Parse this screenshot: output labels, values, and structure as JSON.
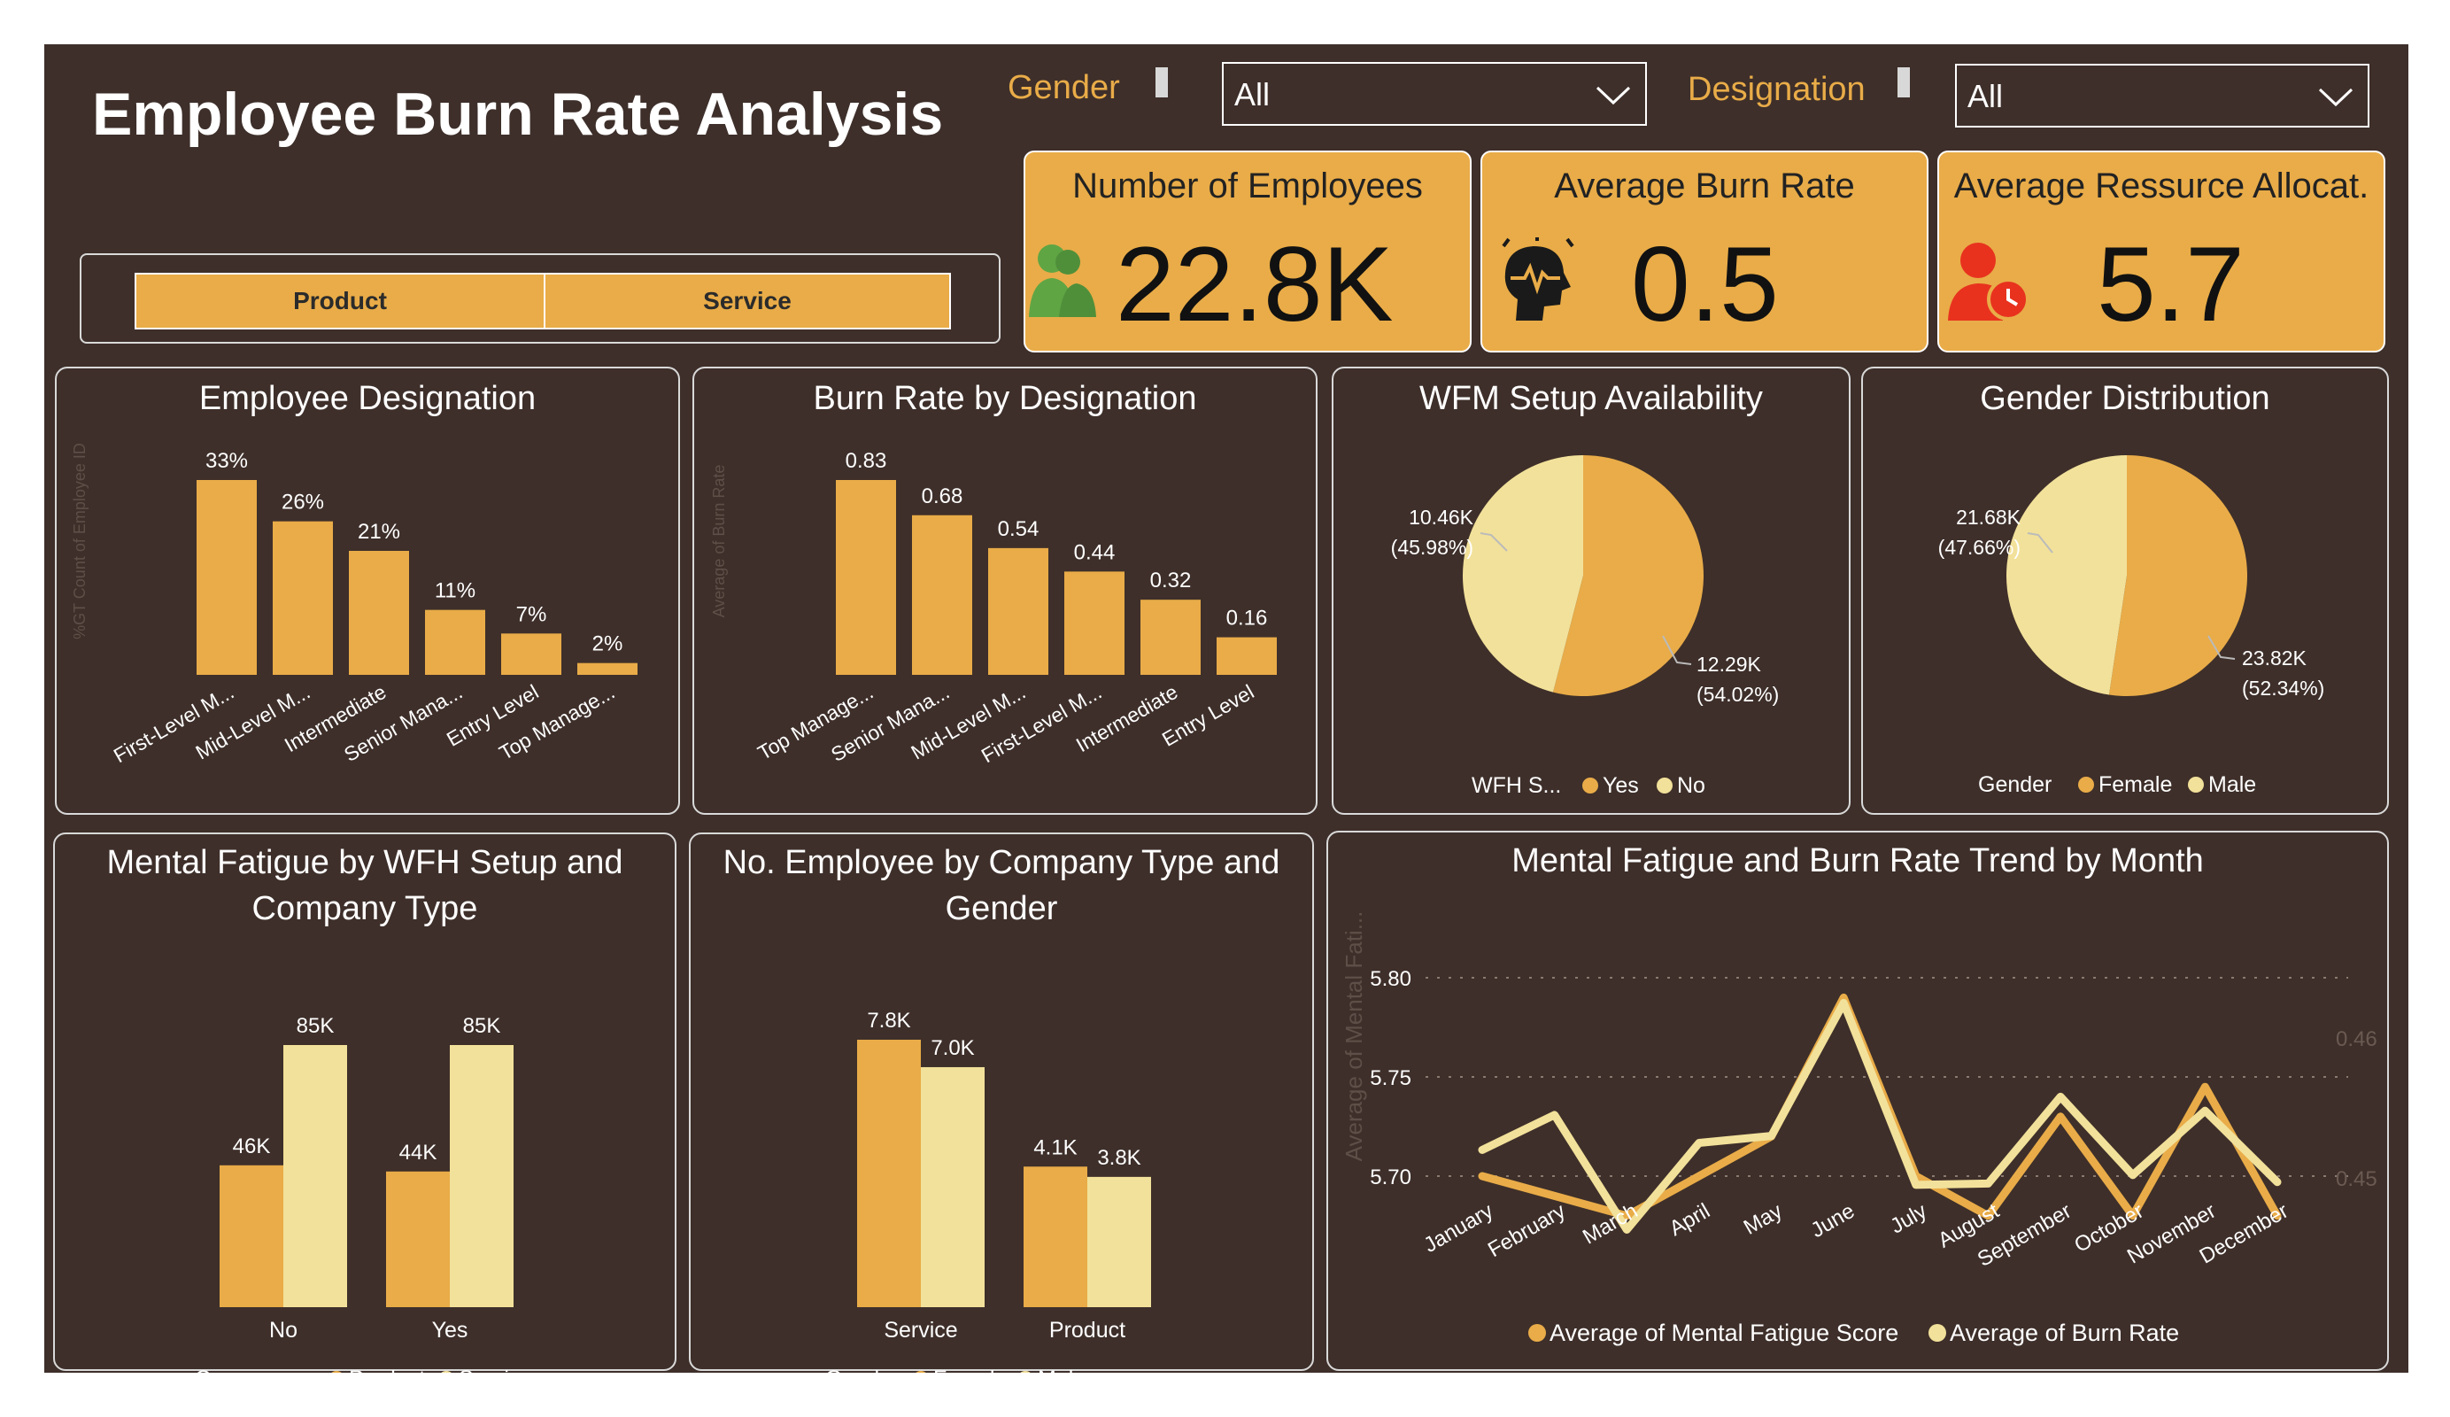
{
  "header": {
    "title": "Employee Burn Rate Analysis",
    "gender_filter": {
      "label": "Gender",
      "value": "All"
    },
    "designation_filter": {
      "label": "Designation",
      "value": "All"
    }
  },
  "slicer": {
    "buttons": [
      "Product",
      "Service"
    ]
  },
  "kpis": [
    {
      "title": "Number of Employees",
      "value": "22.8K",
      "icon": "people-icon"
    },
    {
      "title": "Average Burn Rate",
      "value": "0.5",
      "icon": "burnout-head-icon"
    },
    {
      "title": "Average Ressurce Allocat.",
      "value": "5.7",
      "icon": "user-clock-icon"
    }
  ],
  "colors": {
    "background": "#3e2f2a",
    "accent": "#e9ac48",
    "light": "#f2e19a",
    "text": "#ffffff"
  },
  "panels": {
    "designation": {
      "title": "Employee Designation",
      "ylabel": "%GT Count of Employee ID"
    },
    "burn_by_designation": {
      "title": "Burn Rate by Designation",
      "ylabel": "Average of Burn Rate"
    },
    "wfm": {
      "title": "WFM Setup Availability",
      "legend_title": "WFH S...",
      "legend": [
        "Yes",
        "No"
      ]
    },
    "gender": {
      "title": "Gender Distribution",
      "legend_title": "Gender",
      "legend": [
        "Female",
        "Male"
      ]
    },
    "mental_fatigue": {
      "title_line1": "Mental Fatigue by WFH Setup and",
      "title_line2": "Company Type",
      "legend_title": "Company ...",
      "legend": [
        "Product",
        "Service"
      ]
    },
    "employees_company": {
      "title_line1": "No. Employee by Company Type and",
      "title_line2": "Gender",
      "legend_title": "Gender",
      "legend": [
        "Female",
        "Male"
      ]
    },
    "trend": {
      "title": "Mental Fatigue and Burn Rate Trend by Month",
      "ylabel": "Average of Mental Fati...",
      "legend": [
        "Average of Mental Fatigue Score",
        "Average of Burn Rate"
      ]
    }
  },
  "chart_data": [
    {
      "type": "bar",
      "title": "Employee Designation",
      "ylabel": "%GT Count of Employee ID",
      "categories": [
        "First-Level M...",
        "Mid-Level M...",
        "Intermediate",
        "Senior Mana...",
        "Entry Level",
        "Top Manage..."
      ],
      "values": [
        33,
        26,
        21,
        11,
        7,
        2
      ],
      "labels": [
        "33%",
        "26%",
        "21%",
        "11%",
        "7%",
        "2%"
      ]
    },
    {
      "type": "bar",
      "title": "Burn Rate by Designation",
      "ylabel": "Average of Burn Rate",
      "categories": [
        "Top Manage...",
        "Senior Mana...",
        "Mid-Level M...",
        "First-Level M...",
        "Intermediate",
        "Entry Level"
      ],
      "values": [
        0.83,
        0.68,
        0.54,
        0.44,
        0.32,
        0.16
      ],
      "labels": [
        "0.83",
        "0.68",
        "0.54",
        "0.44",
        "0.32",
        "0.16"
      ]
    },
    {
      "type": "pie",
      "title": "WFM Setup Availability",
      "categories": [
        "Yes",
        "No"
      ],
      "values": [
        12290,
        10460
      ],
      "labels": [
        "12.29K",
        "10.46K"
      ],
      "percents": [
        "(54.02%)",
        "(45.98%)"
      ]
    },
    {
      "type": "pie",
      "title": "Gender Distribution",
      "categories": [
        "Female",
        "Male"
      ],
      "values": [
        23820,
        21680
      ],
      "labels": [
        "23.82K",
        "21.68K"
      ],
      "percents": [
        "(52.34%)",
        "(47.66%)"
      ]
    },
    {
      "type": "bar",
      "title": "Mental Fatigue by WFH Setup and Company Type",
      "categories": [
        "No",
        "Yes"
      ],
      "series": [
        {
          "name": "Product",
          "values": [
            46000,
            44000
          ],
          "labels": [
            "46K",
            "44K"
          ]
        },
        {
          "name": "Service",
          "values": [
            85000,
            85000
          ],
          "labels": [
            "85K",
            "85K"
          ]
        }
      ]
    },
    {
      "type": "bar",
      "title": "No. Employee by Company Type and Gender",
      "categories": [
        "Service",
        "Product"
      ],
      "series": [
        {
          "name": "Female",
          "values": [
            7800,
            4100
          ],
          "labels": [
            "7.8K",
            "4.1K"
          ]
        },
        {
          "name": "Male",
          "values": [
            7000,
            3800
          ],
          "labels": [
            "7.0K",
            "3.8K"
          ]
        }
      ]
    },
    {
      "type": "line",
      "title": "Mental Fatigue and Burn Rate Trend by Month",
      "ylabel": "Average of Mental Fati...",
      "x": [
        "January",
        "February",
        "March",
        "April",
        "May",
        "June",
        "July",
        "August",
        "September",
        "October",
        "November",
        "December"
      ],
      "yticks_left": [
        "5.80",
        "5.75",
        "5.70"
      ],
      "yticks_right": [
        "0.46",
        "0.45"
      ],
      "series": [
        {
          "name": "Average of Mental Fatigue Score",
          "axis": "left",
          "values": [
            5.7,
            5.69,
            5.68,
            5.7,
            5.72,
            5.79,
            5.7,
            5.68,
            5.73,
            5.68,
            5.745,
            5.68
          ]
        },
        {
          "name": "Average of Burn Rate",
          "axis": "right",
          "values": [
            0.452,
            0.4545,
            0.4463,
            0.4525,
            0.453,
            0.4625,
            0.4495,
            0.4496,
            0.4558,
            0.4502,
            0.4548,
            0.4497
          ]
        }
      ]
    }
  ]
}
